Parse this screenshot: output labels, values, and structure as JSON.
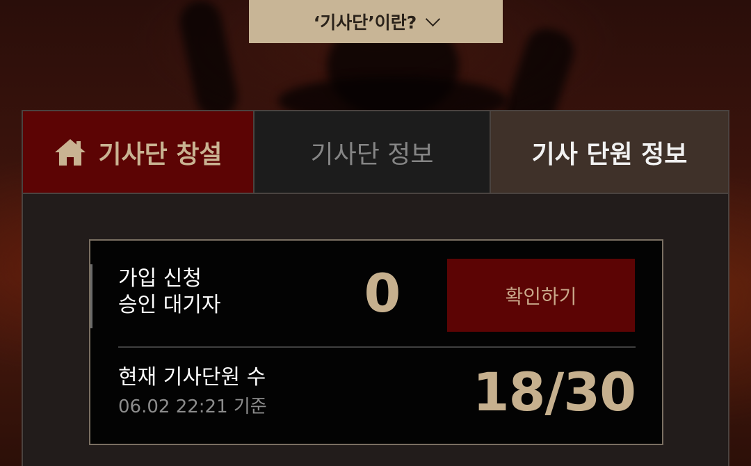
{
  "faq": {
    "label": "‘기사단’이란?",
    "icon": "chevron-down-icon"
  },
  "tabs": {
    "create": {
      "label": "기사단 창설",
      "icon": "home-icon"
    },
    "guild_info": {
      "label": "기사단 정보"
    },
    "member_info": {
      "label": "기사 단원 정보"
    }
  },
  "pending": {
    "label_line1": "가입 신청",
    "label_line2": "승인 대기자",
    "count": "0",
    "confirm_label": "확인하기"
  },
  "members": {
    "label": "현재 기사단원 수",
    "timestamp": "06.02 22:21 기준",
    "count": "18/30"
  },
  "colors": {
    "accent_red": "#5c0404",
    "gold": "#c6b08e",
    "faq_bg": "#c8b596",
    "selected_tab": "#3f3129"
  }
}
